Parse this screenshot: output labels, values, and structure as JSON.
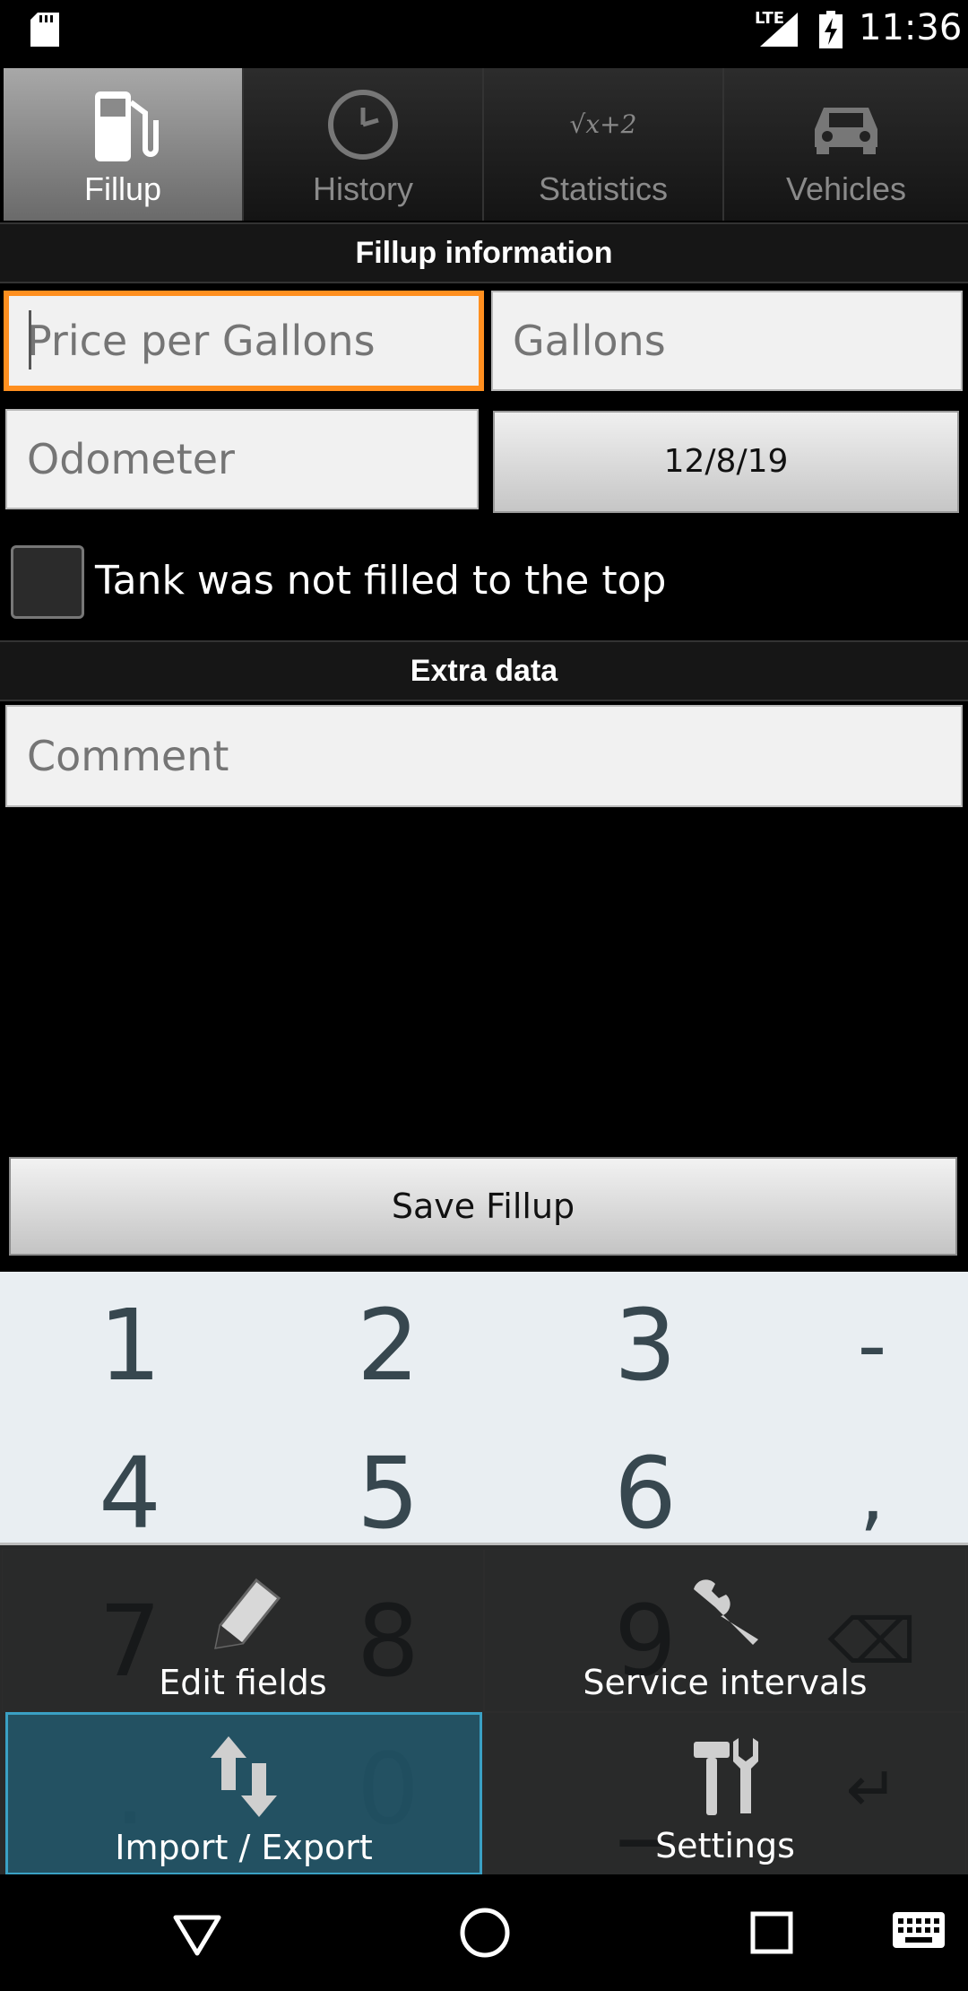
{
  "status_bar": {
    "network": "LTE",
    "time": "11:36"
  },
  "tabs": [
    {
      "label": "Fillup",
      "icon": "fuel-pump-icon",
      "active": true
    },
    {
      "label": "History",
      "icon": "clock-icon",
      "active": false
    },
    {
      "label": "Statistics",
      "icon": "sqrt-formula-icon",
      "active": false,
      "icon_text": "√x+2"
    },
    {
      "label": "Vehicles",
      "icon": "car-icon",
      "active": false
    }
  ],
  "fillup_section": {
    "title": "Fillup information",
    "price_placeholder": "Price per Gallons",
    "gallons_placeholder": "Gallons",
    "odometer_placeholder": "Odometer",
    "date": "12/8/19",
    "not_full_label": "Tank was not filled to the top",
    "not_full_checked": false
  },
  "extra_section": {
    "title": "Extra data",
    "comment_placeholder": "Comment"
  },
  "save_label": "Save Fillup",
  "keyboard": {
    "keys": [
      "1",
      "2",
      "3",
      "-",
      "4",
      "5",
      "6",
      ",",
      "7",
      "8",
      "9",
      "⌫",
      ".",
      "0",
      "_",
      "↵"
    ]
  },
  "menu": {
    "items": [
      {
        "label": "Edit fields",
        "icon": "pencil-icon"
      },
      {
        "label": "Service intervals",
        "icon": "wrench-icon"
      },
      {
        "label": "Import / Export",
        "icon": "import-export-arrows-icon",
        "highlighted": true
      },
      {
        "label": "Settings",
        "icon": "tools-icon"
      }
    ]
  },
  "colors": {
    "focus_border": "#ff8f1f",
    "menu_highlight": "#22586c",
    "keyboard_bg": "#e9eef2"
  }
}
